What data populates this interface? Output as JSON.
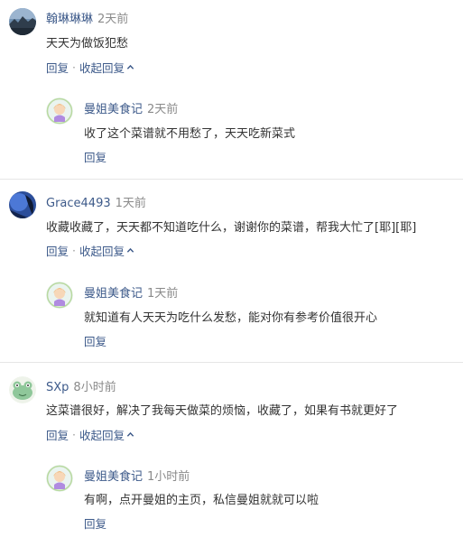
{
  "comments": [
    {
      "user": "翰琳琳琳",
      "time": "2天前",
      "text": "天天为做饭犯愁",
      "reply_label": "回复",
      "separator": "·",
      "collapse_label": "收起回复",
      "reply": {
        "user": "曼姐美食记",
        "time": "2天前",
        "text": "收了这个菜谱就不用愁了，天天吃新菜式",
        "reply_label": "回复"
      }
    },
    {
      "user": "Grace4493",
      "time": "1天前",
      "text": "收藏收藏了，天天都不知道吃什么，谢谢你的菜谱，帮我大忙了[耶][耶]",
      "reply_label": "回复",
      "separator": "·",
      "collapse_label": "收起回复",
      "reply": {
        "user": "曼姐美食记",
        "time": "1天前",
        "text": "就知道有人天天为吃什么发愁，能对你有参考价值很开心",
        "reply_label": "回复"
      }
    },
    {
      "user": "SXp",
      "time": "8小时前",
      "text": "这菜谱很好，解决了我每天做菜的烦恼，收藏了，如果有书就更好了",
      "reply_label": "回复",
      "separator": "·",
      "collapse_label": "收起回复",
      "reply": {
        "user": "曼姐美食记",
        "time": "1小时前",
        "text": "有啊，点开曼姐的主页，私信曼姐就就可以啦",
        "reply_label": "回复"
      }
    }
  ],
  "colors": {
    "username": "#3d5a8a",
    "timestamp": "#8a8a8a",
    "body_text": "#333333",
    "action_link": "#3d5a8a"
  }
}
